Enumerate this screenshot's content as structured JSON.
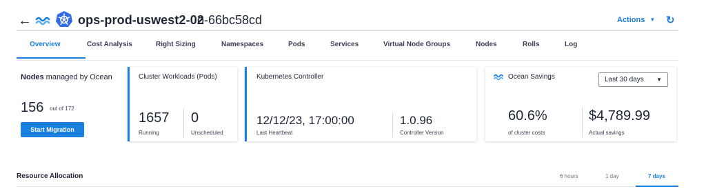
{
  "header": {
    "cluster_name": "ops-prod-uswest2-02",
    "cluster_id": "o-66bc58cd",
    "actions_label": "Actions",
    "icons": {
      "back": "back-arrow-icon",
      "ocean": "ocean-waves-icon",
      "kubernetes": "kubernetes-icon",
      "refresh": "refresh-icon"
    }
  },
  "tabs": [
    {
      "label": "Overview",
      "active": true
    },
    {
      "label": "Cost Analysis"
    },
    {
      "label": "Right Sizing"
    },
    {
      "label": "Namespaces"
    },
    {
      "label": "Pods"
    },
    {
      "label": "Services"
    },
    {
      "label": "Virtual Node Groups"
    },
    {
      "label": "Nodes"
    },
    {
      "label": "Rolls"
    },
    {
      "label": "Log"
    }
  ],
  "nodes_card": {
    "title_bold": "Nodes",
    "title_rest": " managed by Ocean",
    "count": "156",
    "out_of": "out of 172",
    "button_label": "Start Migration"
  },
  "workloads_card": {
    "title": "Cluster Workloads (Pods)",
    "running_value": "1657",
    "running_label": "Running",
    "unscheduled_value": "0",
    "unscheduled_label": "Unscheduled"
  },
  "controller_card": {
    "title": "Kubernetes Controller",
    "heartbeat_value": "12/12/23, 17:00:00",
    "heartbeat_label": "Last Heartbeat",
    "version_value": "1.0.96",
    "version_label": "Controller Version"
  },
  "savings_card": {
    "title": "Ocean Savings",
    "period_selected": "Last 30 days",
    "percent_value": "60.6%",
    "percent_label": "of cluster costs",
    "amount_value": "$4,789.99",
    "amount_label": "Actual savings"
  },
  "resource_allocation": {
    "title": "Resource Allocation",
    "ranges": [
      {
        "label": "6 hours"
      },
      {
        "label": "1 day"
      },
      {
        "label": "7 days",
        "active": true
      }
    ]
  },
  "colors": {
    "accent": "#1b7fe0",
    "text": "#1d2433"
  }
}
